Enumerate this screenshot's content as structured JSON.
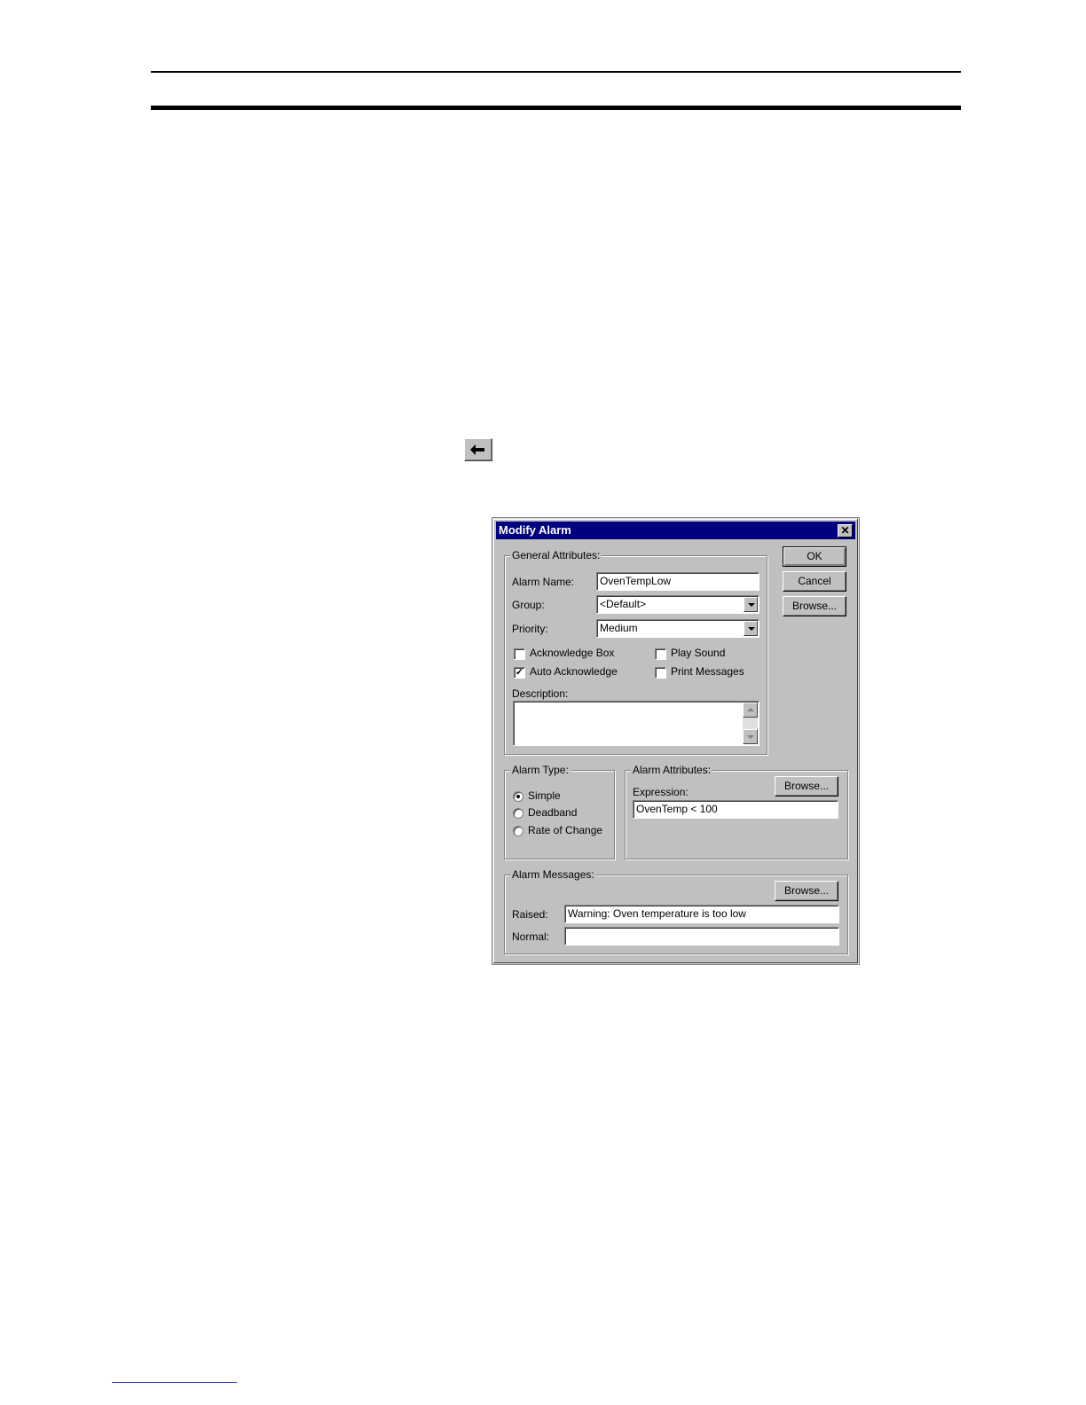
{
  "dialog": {
    "title": "Modify Alarm",
    "close_glyph": "✕",
    "buttons": {
      "ok": "OK",
      "cancel": "Cancel",
      "browse": "Browse..."
    },
    "general": {
      "label": "General Attributes:",
      "alarm_name_label": "Alarm Name:",
      "alarm_name_value": "OvenTempLow",
      "group_label": "Group:",
      "group_value": "<Default>",
      "priority_label": "Priority:",
      "priority_value": "Medium",
      "acknowledge_box": {
        "label": "Acknowledge Box",
        "checked": false
      },
      "auto_acknowledge": {
        "label": "Auto Acknowledge",
        "checked": true
      },
      "play_sound": {
        "label": "Play Sound",
        "checked": false
      },
      "print_messages": {
        "label": "Print  Messages",
        "checked": false
      },
      "description_label": "Description:",
      "description_value": ""
    },
    "alarm_type": {
      "label": "Alarm Type:",
      "options": [
        "Simple",
        "Deadband",
        "Rate of Change"
      ],
      "selected": "Simple"
    },
    "alarm_attributes": {
      "label": "Alarm Attributes:",
      "browse_label": "Browse...",
      "expression_label": "Expression:",
      "expression_value": "OvenTemp < 100"
    },
    "alarm_messages": {
      "label": "Alarm Messages:",
      "browse_label": "Browse...",
      "raised_label": "Raised:",
      "raised_value": "Warning: Oven temperature is too low",
      "normal_label": "Normal:",
      "normal_value": ""
    }
  },
  "icons": {
    "toolbar_button": "left-arrow-icon",
    "check_glyph": "✓"
  },
  "colors": {
    "titlebar": "#000080",
    "dialog_bg": "#c0c0c0",
    "footer_link": "#1a2fb8"
  }
}
